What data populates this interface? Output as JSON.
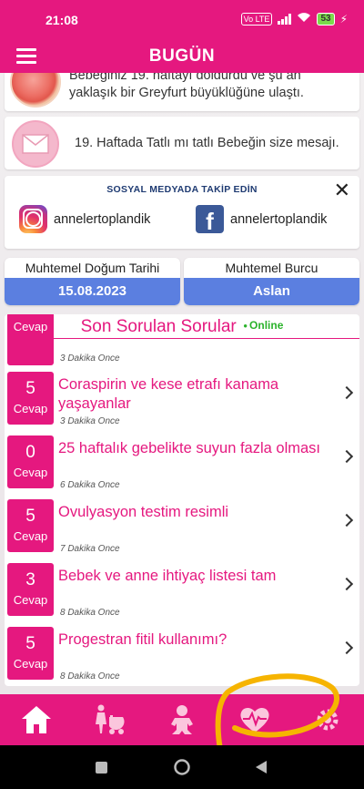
{
  "status_bar": {
    "time": "21:08",
    "volte": "Vo LTE",
    "battery": "53"
  },
  "header": {
    "title": "BUGÜN"
  },
  "week_card": {
    "text": "Bebeğiniz 19. haftayı doldurdu ve şu an yaklaşık bir Greyfurt büyüklüğüne ulaştı."
  },
  "message_card": {
    "text": "19. Haftada Tatlı mı tatlı Bebeğin size mesajı."
  },
  "social": {
    "heading": "SOSYAL MEDYADA TAKİP EDİN",
    "instagram": "annelertoplandik",
    "facebook": "annelertoplandik",
    "close": "✕"
  },
  "due_date": {
    "label": "Muhtemel Doğum Tarihi",
    "value": "15.08.2023"
  },
  "zodiac": {
    "label": "Muhtemel Burcu",
    "value": "Aslan"
  },
  "questions": {
    "title": "Son Sorulan Sorular",
    "online": "Online",
    "answer_word": "Cevap",
    "items": [
      {
        "count": "",
        "title": "",
        "time": "3 Dakika Once"
      },
      {
        "count": "5",
        "title": "Coraspirin ve kese etrafı kanama yaşayanlar",
        "time": "3 Dakika Once"
      },
      {
        "count": "0",
        "title": "25 haftalık gebelikte suyun fazla olması",
        "time": "6 Dakika Once"
      },
      {
        "count": "5",
        "title": "Ovulyasyon testim resimli",
        "time": "7 Dakika Once"
      },
      {
        "count": "3",
        "title": "Bebek ve anne ihtiyaç listesi tam",
        "time": "8 Dakika Once"
      },
      {
        "count": "5",
        "title": "Progestran fitil kullanımı?",
        "time": "8 Dakika Once"
      }
    ]
  },
  "bottom_nav": [
    "home-icon",
    "stroller-mother-icon",
    "baby-icon",
    "heartbeat-icon",
    "settings-icon"
  ],
  "colors": {
    "primary": "#e5187f",
    "accent_blue": "#5b7fe0",
    "online": "#2bb32b"
  }
}
